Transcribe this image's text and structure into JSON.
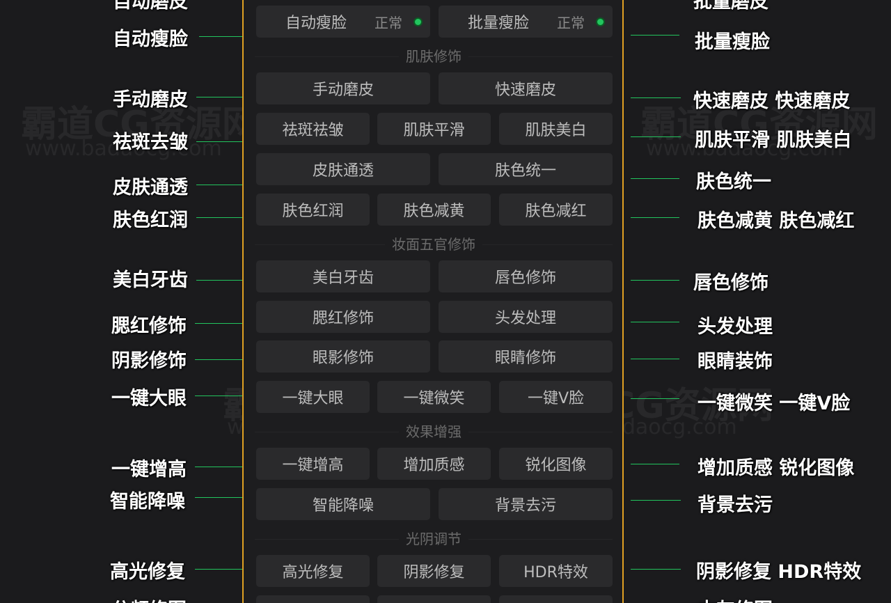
{
  "colors": {
    "accent_border": "#e0a022",
    "status_ok": "#22c55e",
    "button_bg": "#2a2a2c",
    "connector": "#22c55e"
  },
  "watermarks": {
    "brand": "霸道CG资源网",
    "url": "www.badaocg.com"
  },
  "top_partial": {
    "left_label": "自动磨皮",
    "right_label": "批量磨皮"
  },
  "row_auto": {
    "auto_slim": {
      "label": "自动瘦脸",
      "state": "正常"
    },
    "batch_slim": {
      "label": "批量瘦脸",
      "state": "正常"
    }
  },
  "sections": {
    "skin": "肌肤修饰",
    "makeup": "妆面五官修饰",
    "effects": "效果增强",
    "light": "光阴调节"
  },
  "buttons": {
    "manual_smooth": "手动磨皮",
    "quick_smooth": "快速磨皮",
    "spot_wrinkle": "祛斑祛皱",
    "skin_smooth": "肌肤平滑",
    "skin_whiten": "肌肤美白",
    "skin_clear": "皮肤通透",
    "tone_unify": "肤色统一",
    "tone_rosy": "肤色红润",
    "tone_less_yellow": "肤色减黄",
    "tone_less_red": "肤色减红",
    "teeth_whiten": "美白牙齿",
    "lip_color": "唇色修饰",
    "blush": "腮红修饰",
    "hair": "头发处理",
    "eyeshadow": "眼影修饰",
    "eyes": "眼睛修饰",
    "big_eyes": "一键大眼",
    "smile": "一键微笑",
    "v_face": "一键V脸",
    "heighten": "一键增高",
    "texture": "增加质感",
    "sharpen": "锐化图像",
    "denoise": "智能降噪",
    "bg_clean": "背景去污",
    "highlight_fix": "高光修复",
    "shadow_fix": "阴影修复",
    "hdr": "HDR特效"
  },
  "left_labels": {
    "auto_slim": "自动瘦脸",
    "manual_smooth": "手动磨皮",
    "spot_wrinkle": "祛斑去皱",
    "skin_clear": "皮肤通透",
    "tone_rosy": "肤色红润",
    "teeth_whiten": "美白牙齿",
    "blush": "腮红修饰",
    "eyeshadow": "阴影修饰",
    "big_eyes": "一键大眼",
    "heighten": "一键增高",
    "denoise": "智能降噪",
    "highlight_fix": "高光修复",
    "bottom_partial": "分频修图"
  },
  "right_labels": {
    "batch_slim": "批量瘦脸",
    "quick_smooth": "快速磨皮  快速磨皮",
    "skin_smooth": "肌肤平滑  肌肤美白",
    "tone_unify": "肤色统一",
    "tone_yellow_red": "肤色减黄 肤色减红",
    "lip_color": "唇色修饰",
    "hair": "头发处理",
    "eyes": "眼睛装饰",
    "smile_v": "一键微笑 一键V脸",
    "texture_sharpen": "增加质感 锐化图像",
    "bg_clean": "背景去污",
    "shadow_hdr": "阴影修复 HDR特效",
    "bottom_partial": "中灰修图"
  }
}
